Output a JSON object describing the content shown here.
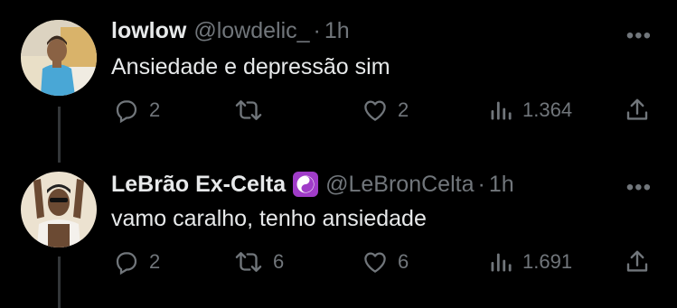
{
  "tweets": [
    {
      "display_name": "lowlow",
      "handle": "@lowdelic_",
      "dot": "·",
      "time": "1h",
      "text": "Ansiedade e depressão sim",
      "replies": "2",
      "retweets": "",
      "likes": "2",
      "views": "1.364",
      "more": "•••"
    },
    {
      "display_name": "LeBrão Ex-Celta",
      "badge_icon": "yin-yang-icon",
      "handle": "@LeBronCelta",
      "dot": "·",
      "time": "1h",
      "text": "vamo caralho, tenho ansiedade",
      "replies": "2",
      "retweets": "6",
      "likes": "6",
      "views": "1.691",
      "more": "•••"
    }
  ],
  "colors": {
    "background": "#000000",
    "primary_text": "#e7e9ea",
    "secondary_text": "#71767b",
    "thread_line": "#333639",
    "badge": "#a03cc8"
  }
}
